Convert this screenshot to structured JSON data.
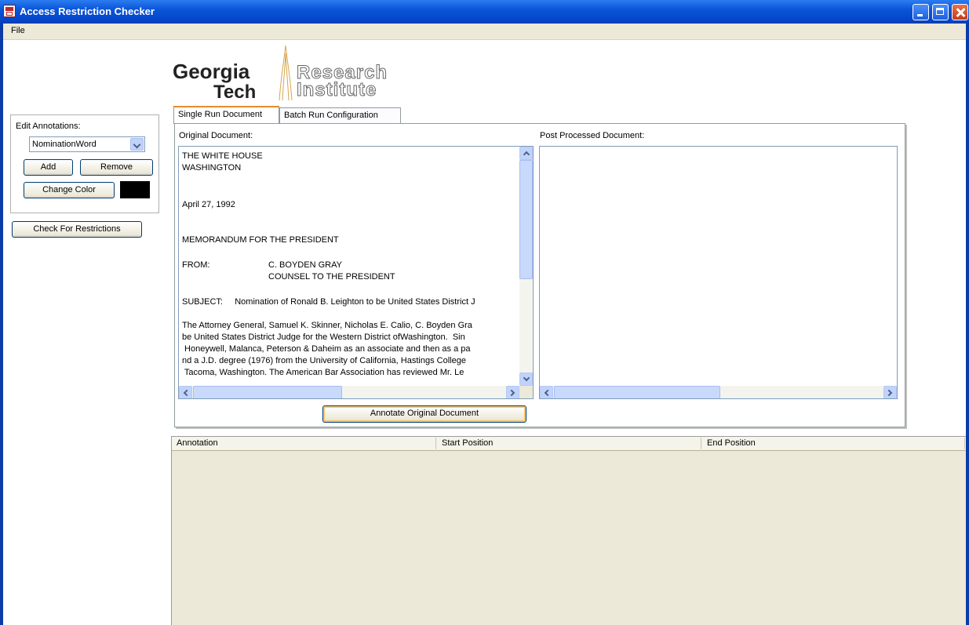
{
  "window": {
    "title": "Access Restriction Checker",
    "buttons": [
      "minimize",
      "maximize",
      "close"
    ]
  },
  "menubar": {
    "items": [
      "File"
    ]
  },
  "logo": {
    "line1": "Georgia",
    "line2": "Tech",
    "line3": "Research",
    "line4": "Institute"
  },
  "left_panel": {
    "edit_label": "Edit Annotations:",
    "annotation_selected": "NominationWord",
    "add_label": "Add",
    "remove_label": "Remove",
    "change_color_label": "Change Color",
    "swatch_color": "#000000",
    "check_label": "Check For Restrictions"
  },
  "tabs": [
    {
      "label": "Single Run Document",
      "active": true
    },
    {
      "label": "Batch Run Configuration",
      "active": false
    }
  ],
  "single_run": {
    "original_label": "Original Document:",
    "processed_label": "Post Processed Document:",
    "original_lines": [
      "THE WHITE HOUSE",
      "WASHINGTON",
      "April 27, 1992",
      "MEMORANDUM FOR THE PRESIDENT",
      "FROM:",
      "C. BOYDEN GRAY",
      "COUNSEL TO THE PRESIDENT",
      "SUBJECT:     Nomination of Ronald B. Leighton to be United States District J",
      "The Attorney General, Samuel K. Skinner, Nicholas E. Calio, C. Boyden Gra",
      "be United States District Judge for the Western District ofWashington.  Sin",
      " Honeywell, Malanca, Peterson & Daheim as an associate and then as a pa",
      "nd a J.D. degree (1976) from the University of California, Hastings College",
      " Tacoma, Washington. The American Bar Association has reviewed Mr. Le"
    ],
    "annotate_label": "Annotate Original Document"
  },
  "annotations_table": {
    "columns": [
      "Annotation",
      "Start Position",
      "End Position"
    ],
    "rows": []
  }
}
